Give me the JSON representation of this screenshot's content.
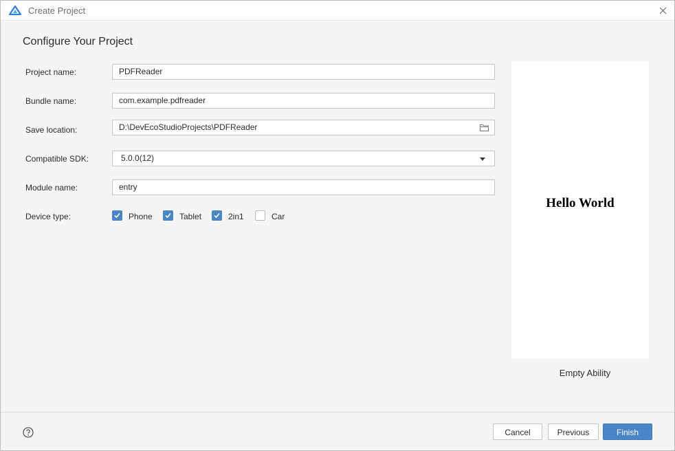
{
  "window": {
    "title": "Create Project"
  },
  "heading": "Configure Your Project",
  "form": {
    "project_name": {
      "label": "Project name:",
      "value": "PDFReader"
    },
    "bundle_name": {
      "label": "Bundle name:",
      "value": "com.example.pdfreader"
    },
    "save_location": {
      "label": "Save location:",
      "value": "D:\\DevEcoStudioProjects\\PDFReader"
    },
    "compatible_sdk": {
      "label": "Compatible SDK:",
      "value": "5.0.0(12)"
    },
    "module_name": {
      "label": "Module name:",
      "value": "entry"
    },
    "device_type": {
      "label": "Device type:",
      "options": [
        {
          "label": "Phone",
          "checked": true
        },
        {
          "label": "Tablet",
          "checked": true
        },
        {
          "label": "2in1",
          "checked": true
        },
        {
          "label": "Car",
          "checked": false
        }
      ]
    }
  },
  "preview": {
    "text": "Hello World",
    "template_name": "Empty Ability"
  },
  "buttons": {
    "cancel": "Cancel",
    "previous": "Previous",
    "finish": "Finish"
  },
  "colors": {
    "accent": "#4a86c5",
    "background": "#f5f5f5"
  },
  "icons": {
    "logo": "deveco-logo-icon",
    "close": "close-icon",
    "folder": "folder-icon",
    "dropdown": "chevron-down-icon",
    "help": "help-icon",
    "check": "check-icon"
  }
}
